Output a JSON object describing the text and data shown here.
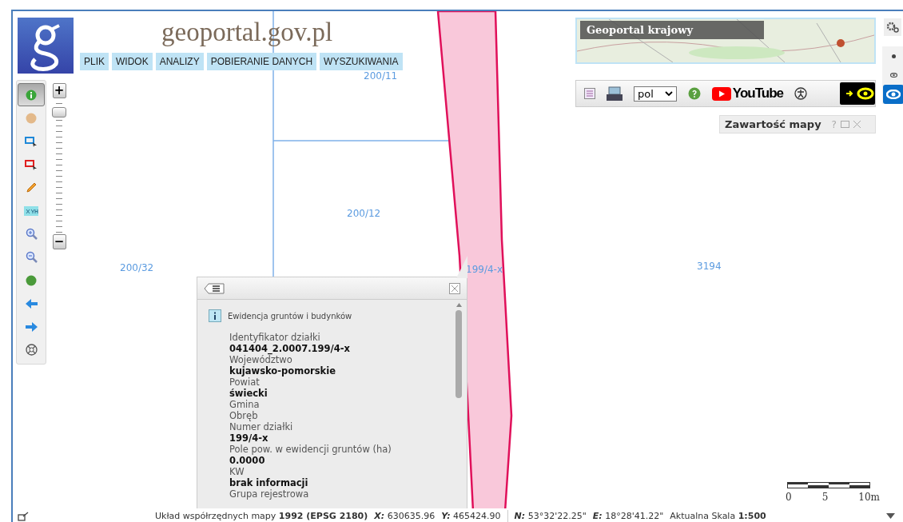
{
  "header": {
    "title": "geoportal.gov.pl",
    "menu": [
      "PLIK",
      "WIDOK",
      "ANALIZY",
      "POBIERANIE DANYCH",
      "WYSZUKIWANIA"
    ]
  },
  "tools": [
    {
      "kind": "info",
      "selected": true
    },
    {
      "kind": "pan",
      "selected": false
    },
    {
      "kind": "select-blue",
      "selected": false
    },
    {
      "kind": "select-red",
      "selected": false
    },
    {
      "kind": "pencil",
      "selected": false
    },
    {
      "kind": "xyh",
      "selected": false
    },
    {
      "kind": "zoom-in",
      "selected": false
    },
    {
      "kind": "zoom-out",
      "selected": false
    },
    {
      "kind": "globe",
      "selected": false
    },
    {
      "kind": "back",
      "selected": false
    },
    {
      "kind": "forward",
      "selected": false
    },
    {
      "kind": "extent",
      "selected": false
    }
  ],
  "zoom": {
    "plus": "+",
    "minus": "−",
    "level": 0.93
  },
  "overview": {
    "label": "Geoportal krajowy"
  },
  "toolbar": {
    "language": "pol",
    "youtube": "YouTube"
  },
  "map_content": {
    "title": "Zawartość mapy",
    "help": "?"
  },
  "view_modes": [
    {
      "kind": "dot",
      "selected": false
    },
    {
      "kind": "eye",
      "selected": false
    },
    {
      "kind": "eye",
      "selected": true
    }
  ],
  "map_labels": [
    {
      "text": "200/11"
    },
    {
      "text": "200/12"
    },
    {
      "text": "200/32"
    },
    {
      "text": "199/4-x"
    },
    {
      "text": "3194"
    }
  ],
  "popup": {
    "source": "Ewidencja gruntów i budynków",
    "fields": [
      {
        "label": "Identyfikator działki",
        "value": "041404_2.0007.199/4-x"
      },
      {
        "label": "Województwo",
        "value": "kujawsko-pomorskie"
      },
      {
        "label": "Powiat",
        "value": "świecki"
      },
      {
        "label": "Gmina"
      },
      {
        "label": "Obręb"
      },
      {
        "label": "Numer działki",
        "value": "199/4-x"
      },
      {
        "label": "Pole pow. w ewidencji gruntów (ha)",
        "value": "0.0000"
      },
      {
        "label": "KW",
        "value": "brak informacji"
      },
      {
        "label": "Grupa rejestrowa"
      }
    ]
  },
  "scale": [
    "0",
    "5",
    "10m"
  ],
  "status": {
    "crs": "Układ współrzędnych mapy **1992 (EPSG 2180)**",
    "coords": [
      {
        "label": "X:",
        "value": "630635.96"
      },
      {
        "label": "Y:",
        "value": "465424.90"
      },
      {
        "label": "N:",
        "value": "53°32'22.25\""
      },
      {
        "label": "E:",
        "value": "18°28'41.22\""
      }
    ],
    "scale": "Aktualna Skala **1:500**"
  }
}
